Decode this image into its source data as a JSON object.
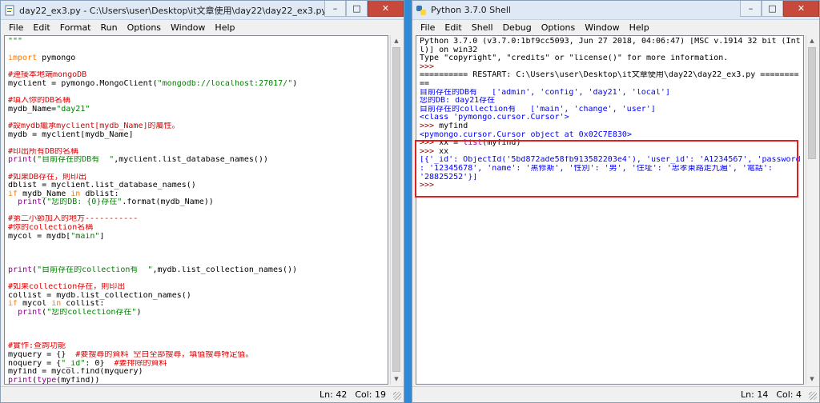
{
  "editor": {
    "title": "day22_ex3.py - C:\\Users\\user\\Desktop\\it文章使用\\day22\\day22_ex3.py (3.7.0)",
    "menu": [
      "File",
      "Edit",
      "Format",
      "Run",
      "Options",
      "Window",
      "Help"
    ],
    "lines": [
      [
        {
          "t": "\"\"\"",
          "c": "str"
        }
      ],
      [],
      [
        {
          "t": "import",
          "c": "kw"
        },
        {
          "t": " pymongo",
          "c": ""
        }
      ],
      [],
      [
        {
          "t": "#連接本地端mongoDB",
          "c": "com"
        }
      ],
      [
        {
          "t": "myclient = pymongo.MongoClient(",
          "c": ""
        },
        {
          "t": "\"mongodb://localhost:27017/\"",
          "c": "str"
        },
        {
          "t": ")",
          "c": ""
        }
      ],
      [],
      [
        {
          "t": "#填入你的DB名稱",
          "c": "com"
        }
      ],
      [
        {
          "t": "mydb_Name=",
          "c": ""
        },
        {
          "t": "\"day21\"",
          "c": "str"
        }
      ],
      [],
      [
        {
          "t": "#設mydb繼承myclient[mydb_Name]的屬性。",
          "c": "com"
        }
      ],
      [
        {
          "t": "mydb = myclient[mydb_Name]",
          "c": ""
        }
      ],
      [],
      [
        {
          "t": "#印出所有DB的名稱",
          "c": "com"
        }
      ],
      [
        {
          "t": "print",
          "c": "bi"
        },
        {
          "t": "(",
          "c": ""
        },
        {
          "t": "\"目前存在的DB有  \"",
          "c": "str"
        },
        {
          "t": ",myclient.list_database_names())",
          "c": ""
        }
      ],
      [],
      [
        {
          "t": "#如果DB存在，則印出",
          "c": "com"
        }
      ],
      [
        {
          "t": "dblist = myclient.list_database_names()",
          "c": ""
        }
      ],
      [
        {
          "t": "if",
          "c": "kw"
        },
        {
          "t": " mydb_Name ",
          "c": ""
        },
        {
          "t": "in",
          "c": "kw"
        },
        {
          "t": " dblist:",
          "c": ""
        }
      ],
      [
        {
          "t": "  ",
          "c": ""
        },
        {
          "t": "print",
          "c": "bi"
        },
        {
          "t": "(",
          "c": ""
        },
        {
          "t": "\"您的DB: {0}存在\"",
          "c": "str"
        },
        {
          "t": ".format(mydb_Name))",
          "c": ""
        }
      ],
      [],
      [
        {
          "t": "#第二小節加入的地方-----------",
          "c": "com"
        }
      ],
      [
        {
          "t": "#你的collection名稱",
          "c": "com"
        }
      ],
      [
        {
          "t": "mycol = mydb[",
          "c": ""
        },
        {
          "t": "\"main\"",
          "c": "str"
        },
        {
          "t": "]",
          "c": ""
        }
      ],
      [],
      [],
      [],
      [
        {
          "t": "print",
          "c": "bi"
        },
        {
          "t": "(",
          "c": ""
        },
        {
          "t": "\"目前存在的collection有  \"",
          "c": "str"
        },
        {
          "t": ",mydb.list_collection_names())",
          "c": ""
        }
      ],
      [],
      [
        {
          "t": "#如果collection存在，則印出",
          "c": "com"
        }
      ],
      [
        {
          "t": "collist = mydb.list_collection_names()",
          "c": ""
        }
      ],
      [
        {
          "t": "if",
          "c": "kw"
        },
        {
          "t": " mycol ",
          "c": ""
        },
        {
          "t": "in",
          "c": "kw"
        },
        {
          "t": " collist:",
          "c": ""
        }
      ],
      [
        {
          "t": "  ",
          "c": ""
        },
        {
          "t": "print",
          "c": "bi"
        },
        {
          "t": "(",
          "c": ""
        },
        {
          "t": "\"您的collection存在\"",
          "c": "str"
        },
        {
          "t": ")",
          "c": ""
        }
      ],
      [],
      [],
      [],
      [
        {
          "t": "#實作:查詢功能",
          "c": "com"
        }
      ],
      [
        {
          "t": "myquery = {}  ",
          "c": ""
        },
        {
          "t": "#要搜尋的資料 空白全部搜尋，填值搜尋特定值。",
          "c": "com"
        }
      ],
      [
        {
          "t": "noquery = {",
          "c": ""
        },
        {
          "t": "\"_id\"",
          "c": "str"
        },
        {
          "t": ": 0}  ",
          "c": ""
        },
        {
          "t": "#要排除的資料",
          "c": "com"
        }
      ],
      [
        {
          "t": "myfind = mycol.find(myquery)",
          "c": ""
        }
      ],
      [
        {
          "t": "print",
          "c": "bi"
        },
        {
          "t": "(",
          "c": ""
        },
        {
          "t": "type",
          "c": "bi"
        },
        {
          "t": "(myfind))",
          "c": ""
        }
      ]
    ],
    "status_ln": "Ln: 42",
    "status_col": "Col: 19"
  },
  "shell": {
    "title": "Python 3.7.0 Shell",
    "menu": [
      "File",
      "Edit",
      "Shell",
      "Debug",
      "Options",
      "Window",
      "Help"
    ],
    "lines": [
      [
        {
          "t": "Python 3.7.0 (v3.7.0:1bf9cc5093, Jun 27 2018, 04:06:47) [MSC v.1914 32 bit (Inte",
          "c": ""
        }
      ],
      [
        {
          "t": "l)] on win32",
          "c": ""
        }
      ],
      [
        {
          "t": "Type \"copyright\", \"credits\" or \"license()\" for more information.",
          "c": ""
        }
      ],
      [
        {
          "t": ">>> ",
          "c": "prompt"
        }
      ],
      [
        {
          "t": "========== RESTART: C:\\Users\\user\\Desktop\\it文章使用\\day22\\day22_ex3.py ========",
          "c": ""
        }
      ],
      [
        {
          "t": "==",
          "c": ""
        }
      ],
      [
        {
          "t": "目前存在的DB有   ['admin', 'config', 'day21', 'local']",
          "c": "out"
        }
      ],
      [
        {
          "t": "您的DB: day21存在",
          "c": "out"
        }
      ],
      [
        {
          "t": "目前存在的collection有   ['main', 'change', 'user']",
          "c": "out"
        }
      ],
      [
        {
          "t": "<class 'pymongo.cursor.Cursor'>",
          "c": "out"
        }
      ],
      [
        {
          "t": ">>> ",
          "c": "prompt"
        },
        {
          "t": "myfind",
          "c": ""
        }
      ],
      [
        {
          "t": "<pymongo.cursor.Cursor object at 0x02C7E830>",
          "c": "out"
        }
      ],
      [
        {
          "t": ">>> ",
          "c": "prompt"
        },
        {
          "t": "xx = ",
          "c": ""
        },
        {
          "t": "list",
          "c": "bi"
        },
        {
          "t": "(myfind)",
          "c": ""
        }
      ],
      [
        {
          "t": ">>> ",
          "c": "prompt"
        },
        {
          "t": "xx",
          "c": ""
        }
      ],
      [
        {
          "t": "[{'_id': ObjectId('5bd872ade58fb913582203e4'), 'user_id': 'A1234567', 'password'",
          "c": "out"
        }
      ],
      [
        {
          "t": ": '12345678', 'name': '黑修斯', '性別': '男', '住址': '忠孝東路走九遍', '電話':",
          "c": "out"
        }
      ],
      [
        {
          "t": "'28825252'}]",
          "c": "out"
        }
      ],
      [
        {
          "t": ">>> ",
          "c": "prompt"
        }
      ]
    ],
    "status_ln": "Ln: 14",
    "status_col": "Col: 4"
  }
}
